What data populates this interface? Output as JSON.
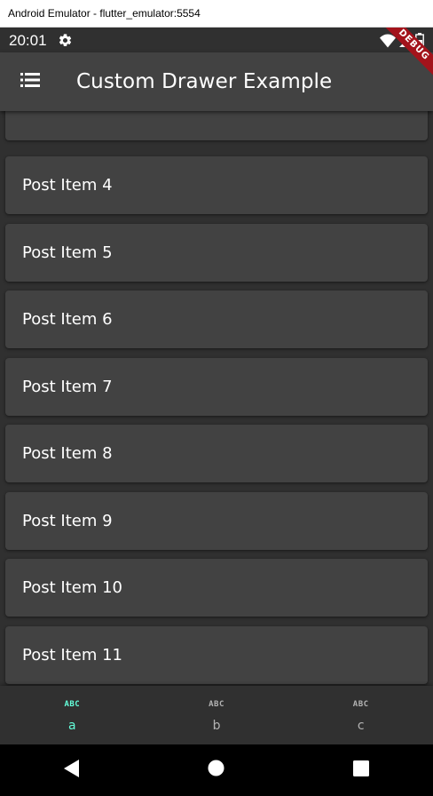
{
  "window": {
    "title": "Android Emulator - flutter_emulator:5554"
  },
  "statusbar": {
    "time": "20:01"
  },
  "appbar": {
    "title": "Custom Drawer Example"
  },
  "debug_banner": {
    "label": "DEBUG"
  },
  "posts": [
    {
      "label": ""
    },
    {
      "label": "Post Item 4"
    },
    {
      "label": "Post Item 5"
    },
    {
      "label": "Post Item 6"
    },
    {
      "label": "Post Item 7"
    },
    {
      "label": "Post Item 8"
    },
    {
      "label": "Post Item 9"
    },
    {
      "label": "Post Item 10"
    },
    {
      "label": "Post Item 11"
    },
    {
      "label": ""
    }
  ],
  "bottom_nav": {
    "items": [
      {
        "icon_text": "ABC",
        "label": "a",
        "active": true
      },
      {
        "icon_text": "ABC",
        "label": "b",
        "active": false
      },
      {
        "icon_text": "ABC",
        "label": "c",
        "active": false
      }
    ],
    "active_color": "#64ffda",
    "inactive_color": "#b3b3b3"
  },
  "colors": {
    "background": "#303030",
    "surface": "#424242",
    "debug": "#a3131b"
  }
}
